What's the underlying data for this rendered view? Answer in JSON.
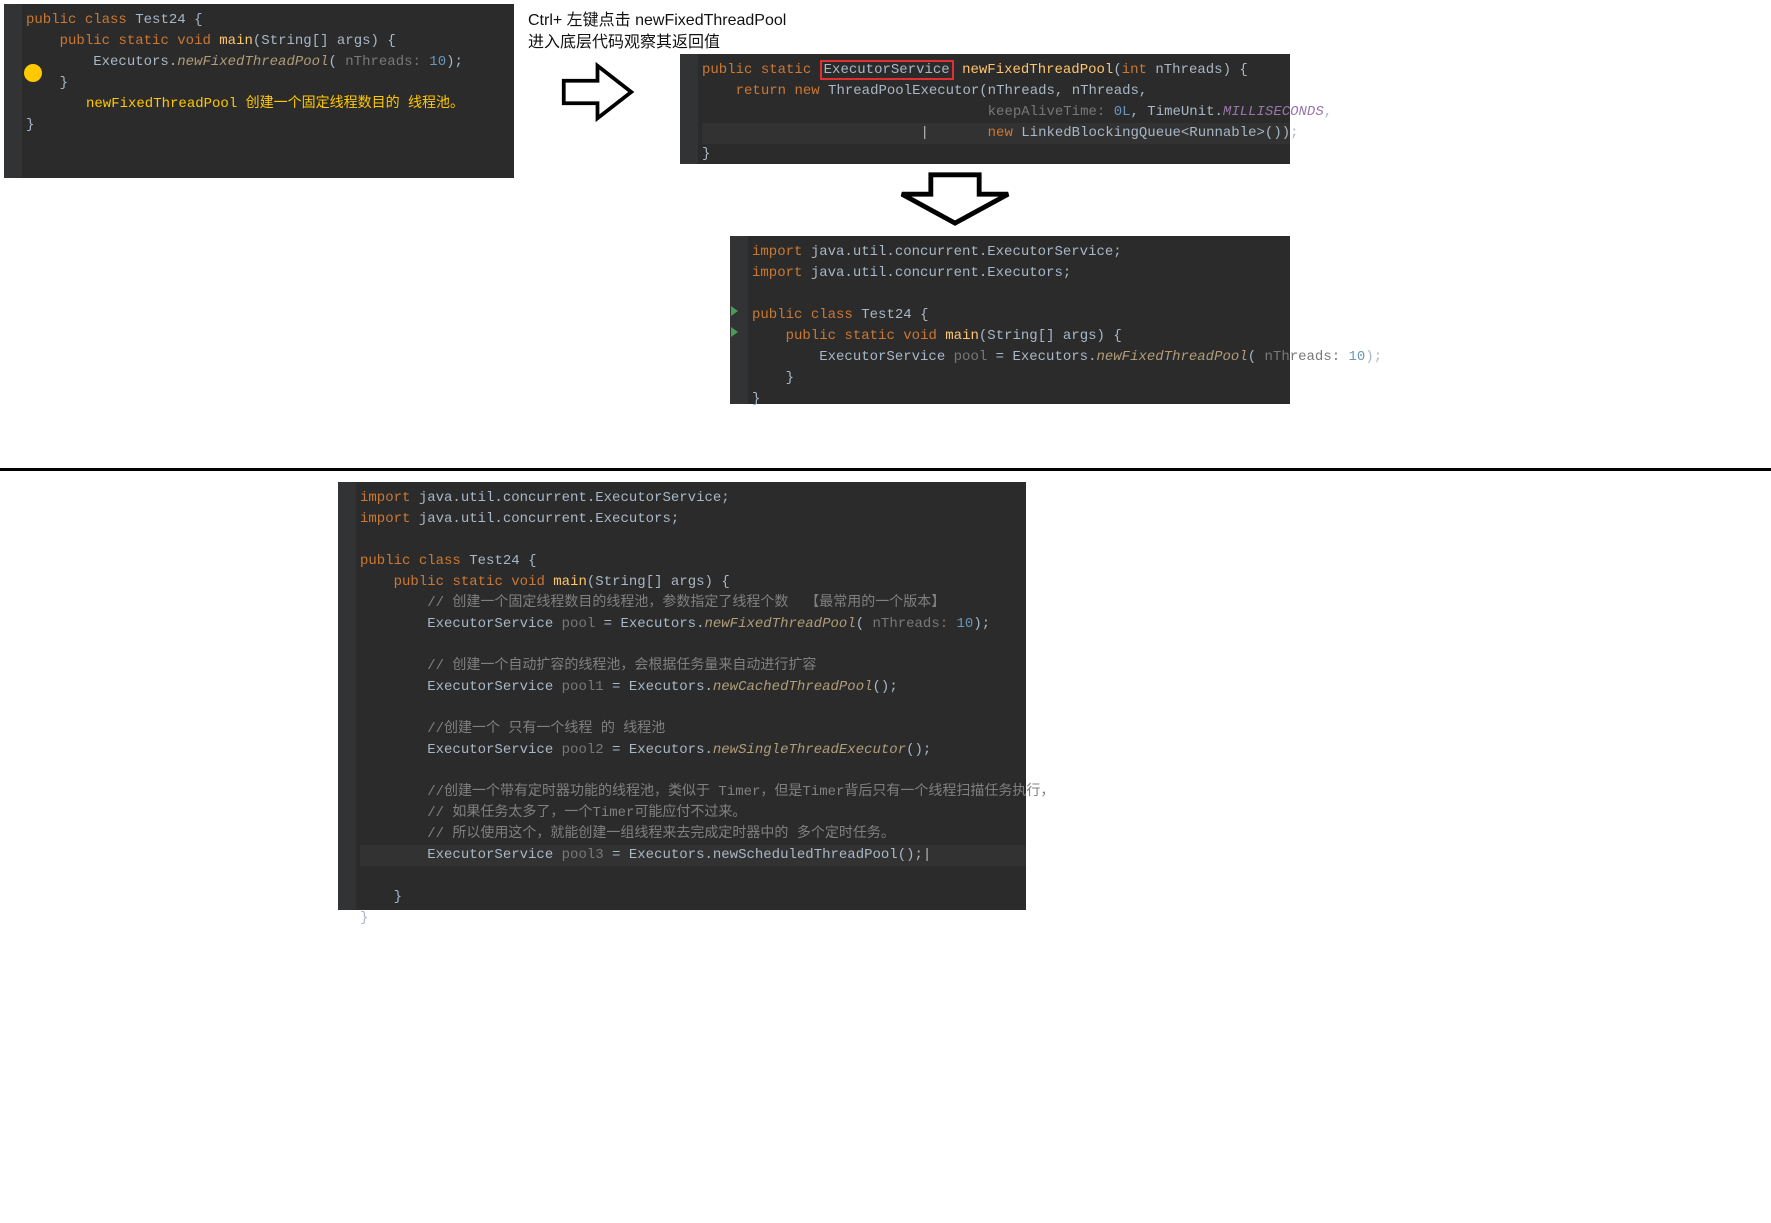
{
  "annotations": {
    "line1": "Ctrl+ 左键点击 newFixedThreadPool",
    "line2": "进入底层代码观察其返回值",
    "tip": "newFixedThreadPool 创建一个固定线程数目的 线程池。"
  },
  "block1": {
    "l1_kw1": "public",
    "l1_kw2": "class",
    "l1_name": "Test24",
    "l1_brace": " {",
    "l2_kw1": "public",
    "l2_kw2": "static",
    "l2_kw3": "void",
    "l2_name": "main",
    "l2_args": "(String[] args) {",
    "l3_cls": "Executors.",
    "l3_method": "newFixedThreadPool",
    "l3_open": "( ",
    "l3_hint": "nThreads: ",
    "l3_num": "10",
    "l3_close": ");",
    "l4": "    }",
    "l5": "}"
  },
  "block2": {
    "l1_kw1": "public",
    "l1_kw2": "static",
    "l1_ret": "ExecutorService",
    "l1_name": "newFixedThreadPool",
    "l1_open": "(",
    "l1_kw3": "int",
    "l1_param": " nThreads) {",
    "l2_kw1": "return",
    "l2_kw2": "new",
    "l2_cls": " ThreadPoolExecutor(nThreads, nThreads,",
    "l3_hint": "keepAliveTime: ",
    "l3_num": "0L",
    "l3_sep": ", TimeUnit.",
    "l3_const": "MILLISECONDS",
    "l3_end": ",",
    "l4_kw": "new",
    "l4_rest": " LinkedBlockingQueue<Runnable>());",
    "l5": "}"
  },
  "block3": {
    "imp1a": "import",
    "imp1b": " java.util.concurrent.ExecutorService;",
    "imp2a": "import",
    "imp2b": " java.util.concurrent.Executors;",
    "l1a": "public",
    "l1b": "class",
    "l1c": "Test24",
    "l1d": " {",
    "l2a": "public",
    "l2b": "static",
    "l2c": "void",
    "l2d": "main",
    "l2e": "(String[] args) {",
    "l3a": "ExecutorService ",
    "l3b": "pool",
    " l3c": " = Executors.",
    "l3d": "newFixedThreadPool",
    "l3e": "( ",
    "l3hint": "nThreads: ",
    "l3num": "10",
    "l3end": ");",
    "l4": "    }",
    "l5": "}"
  },
  "block4": {
    "imp1a": "import",
    "imp1b": " java.util.concurrent.ExecutorService;",
    "imp2a": "import",
    "imp2b": " java.util.concurrent.Executors;",
    "c1a": "public",
    "c1b": "class",
    "c1c": "Test24",
    "c1d": " {",
    "m1a": "public",
    "m1b": "static",
    "m1c": "void",
    "m1d": "main",
    "m1e": "(String[] args) {",
    "cm1": "// 创建一个固定线程数目的线程池，参数指定了线程个数  【最常用的一个版本】",
    "s1a": "ExecutorService ",
    "s1b": "pool",
    "s1c": " = Executors.",
    "s1d": "newFixedThreadPool",
    "s1e": "( ",
    "s1hint": "nThreads: ",
    "s1num": "10",
    "s1end": ");",
    "cm2": "// 创建一个自动扩容的线程池，会根据任务量来自动进行扩容",
    "s2a": "ExecutorService ",
    "s2b": "pool1",
    "s2c": " = Executors.",
    "s2d": "newCachedThreadPool",
    "s2e": "();",
    "cm3": "//创建一个 只有一个线程 的 线程池",
    "s3a": "ExecutorService ",
    "s3b": "pool2",
    "s3c": " = Executors.",
    "s3d": "newSingleThreadExecutor",
    "s3e": "();",
    "cm4": "//创建一个带有定时器功能的线程池，类似于 Timer，但是Timer背后只有一个线程扫描任务执行，",
    "cm5": "// 如果任务太多了，一个Timer可能应付不过来。",
    "cm6": "// 所以使用这个，就能创建一组线程来去完成定时器中的 多个定时任务。",
    "s4a": "ExecutorService ",
    "s4b": "pool3",
    "s4c": " = Executors.newScheduledThreadPool();",
    "end1": "    }",
    "end2": "}"
  }
}
